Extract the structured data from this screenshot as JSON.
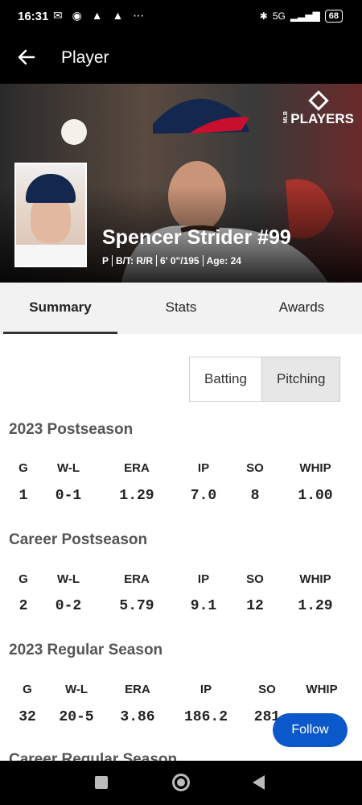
{
  "status_bar": {
    "time": "16:31",
    "battery": "68",
    "network": "5G"
  },
  "app_bar": {
    "title": "Player"
  },
  "hero": {
    "brand": "PLAYERS",
    "brand_prefix": "MLB"
  },
  "player": {
    "name": "Spencer Strider #99",
    "position": "P",
    "bats_throws": "B/T: R/R",
    "height_weight": "6' 0\"/195",
    "age": "Age: 24"
  },
  "tabs": [
    {
      "label": "Summary"
    },
    {
      "label": "Stats"
    },
    {
      "label": "Awards"
    }
  ],
  "toggle": {
    "batting": "Batting",
    "pitching": "Pitching"
  },
  "sections": [
    {
      "title": "2023 Postseason",
      "headers": [
        "G",
        "W-L",
        "ERA",
        "IP",
        "SO",
        "WHIP"
      ],
      "values": [
        "1",
        "0-1",
        "1.29",
        "7.0",
        "8",
        "1.00"
      ]
    },
    {
      "title": "Career Postseason",
      "headers": [
        "G",
        "W-L",
        "ERA",
        "IP",
        "SO",
        "WHIP"
      ],
      "values": [
        "2",
        "0-2",
        "5.79",
        "9.1",
        "12",
        "1.29"
      ]
    },
    {
      "title": "2023 Regular Season",
      "headers": [
        "G",
        "W-L",
        "ERA",
        "IP",
        "SO",
        "WHIP"
      ],
      "values": [
        "32",
        "20-5",
        "3.86",
        "186.2",
        "281",
        ""
      ]
    },
    {
      "title": "Career Regular Season"
    }
  ],
  "follow_button": {
    "label": "Follow"
  }
}
